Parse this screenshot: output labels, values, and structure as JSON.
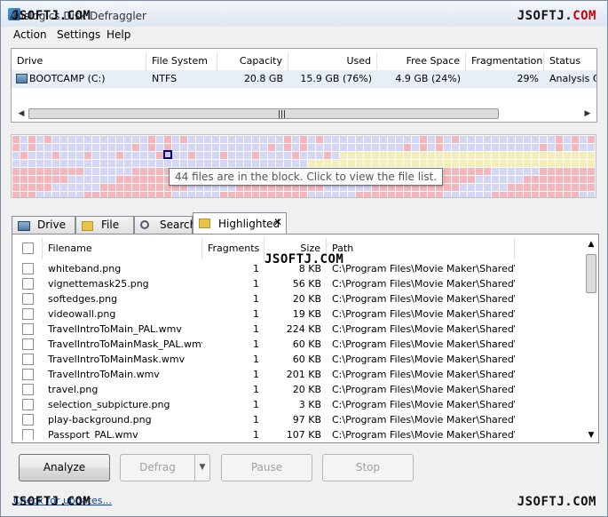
{
  "app": {
    "title": "Auslogics Disk Defraggler"
  },
  "watermark": {
    "prefix": "JSOFTJ.",
    "suffix": "COM"
  },
  "menu": [
    "Action",
    "Settings",
    "Help"
  ],
  "drives": {
    "columns": [
      "Drive",
      "File System",
      "Capacity",
      "Used",
      "Free Space",
      "Fragmentation",
      "Status"
    ],
    "rows": [
      {
        "drive": "BOOTCAMP (C:)",
        "fs": "NTFS",
        "capacity": "20.8 GB",
        "used": "15.9 GB (76%)",
        "free": "4.9 GB (24%)",
        "frag": "29%",
        "status": "Analysis Co"
      }
    ]
  },
  "diskmap": {
    "tooltip": "44 files are in the block. Click to view the file list.",
    "colors": {
      "free": "#c9cdf5",
      "used": "#d4d6f6",
      "fragmented": "#f5b5bd",
      "mft": "#f3edb8",
      "selected": "#000080"
    }
  },
  "tabs": [
    {
      "label": "Drive C:",
      "icon": "drive-icon"
    },
    {
      "label": "File list",
      "icon": "folder-icon"
    },
    {
      "label": "Search",
      "icon": "search-icon"
    },
    {
      "label": "Highlighted",
      "icon": "folder-icon",
      "closable": true
    }
  ],
  "files": {
    "columns": [
      "Filename",
      "Fragments",
      "Size",
      "Path"
    ],
    "rows": [
      {
        "name": "whiteband.png",
        "frags": "1",
        "size": "8 KB",
        "path": "C:\\Program Files\\Movie Maker\\Shared\\..."
      },
      {
        "name": "vignettemask25.png",
        "frags": "1",
        "size": "56 KB",
        "path": "C:\\Program Files\\Movie Maker\\Shared\\..."
      },
      {
        "name": "softedges.png",
        "frags": "1",
        "size": "20 KB",
        "path": "C:\\Program Files\\Movie Maker\\Shared\\..."
      },
      {
        "name": "videowall.png",
        "frags": "1",
        "size": "19 KB",
        "path": "C:\\Program Files\\Movie Maker\\Shared\\..."
      },
      {
        "name": "TravelIntroToMain_PAL.wmv",
        "frags": "1",
        "size": "224 KB",
        "path": "C:\\Program Files\\Movie Maker\\Shared\\..."
      },
      {
        "name": "TravelIntroToMainMask_PAL.wmv",
        "frags": "1",
        "size": "60 KB",
        "path": "C:\\Program Files\\Movie Maker\\Shared\\..."
      },
      {
        "name": "TravelIntroToMainMask.wmv",
        "frags": "1",
        "size": "60 KB",
        "path": "C:\\Program Files\\Movie Maker\\Shared\\..."
      },
      {
        "name": "TravelIntroToMain.wmv",
        "frags": "1",
        "size": "201 KB",
        "path": "C:\\Program Files\\Movie Maker\\Shared\\..."
      },
      {
        "name": "travel.png",
        "frags": "1",
        "size": "20 KB",
        "path": "C:\\Program Files\\Movie Maker\\Shared\\..."
      },
      {
        "name": "selection_subpicture.png",
        "frags": "1",
        "size": "3 KB",
        "path": "C:\\Program Files\\Movie Maker\\Shared\\..."
      },
      {
        "name": "play-background.png",
        "frags": "1",
        "size": "97 KB",
        "path": "C:\\Program Files\\Movie Maker\\Shared\\..."
      },
      {
        "name": "Passport_PAL.wmv",
        "frags": "1",
        "size": "107 KB",
        "path": "C:\\Program Files\\Movie Maker\\Shared\\..."
      }
    ]
  },
  "buttons": {
    "analyze": "Analyze",
    "defrag": "Defrag",
    "pause": "Pause",
    "stop": "Stop"
  },
  "footer": {
    "link": "Check for updates..."
  }
}
